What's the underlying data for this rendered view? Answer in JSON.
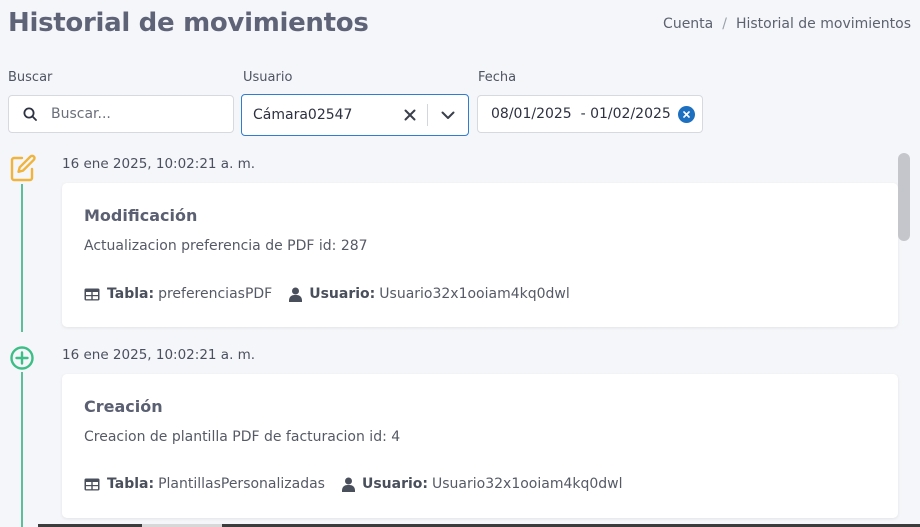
{
  "header": {
    "title": "Historial de movimientos",
    "breadcrumb": [
      "Cuenta",
      "/",
      "Historial de movimientos"
    ]
  },
  "filters": {
    "search": {
      "label": "Buscar",
      "placeholder": "Buscar...",
      "value": ""
    },
    "user": {
      "label": "Usuario",
      "value": "Cámara02547"
    },
    "date": {
      "label": "Fecha",
      "value": "08/01/2025  - 01/02/2025"
    }
  },
  "events": [
    {
      "time": "16 ene 2025, 10:02:21 a. m.",
      "icon": "edit-icon",
      "icon_color": "#f0b43e",
      "title": "Modificación",
      "description": "Actualizacion preferencia de PDF id: 287",
      "table_label": "Tabla:",
      "table_value": "preferenciasPDF",
      "user_label": "Usuario:",
      "user_value": "Usuario32x1ooiam4kq0dwl"
    },
    {
      "time": "16 ene 2025, 10:02:21 a. m.",
      "icon": "plus-circle-icon",
      "icon_color": "#3bbf86",
      "title": "Creación",
      "description": "Creacion de plantilla PDF de facturacion id: 4",
      "table_label": "Tabla:",
      "table_value": "PlantillasPersonalizadas",
      "user_label": "Usuario:",
      "user_value": "Usuario32x1ooiam4kq0dwl"
    }
  ],
  "colors": {
    "accent": "#2f7cd1",
    "timeline": "#5cbf9a",
    "edit": "#f0b43e",
    "create": "#3bbf86"
  }
}
